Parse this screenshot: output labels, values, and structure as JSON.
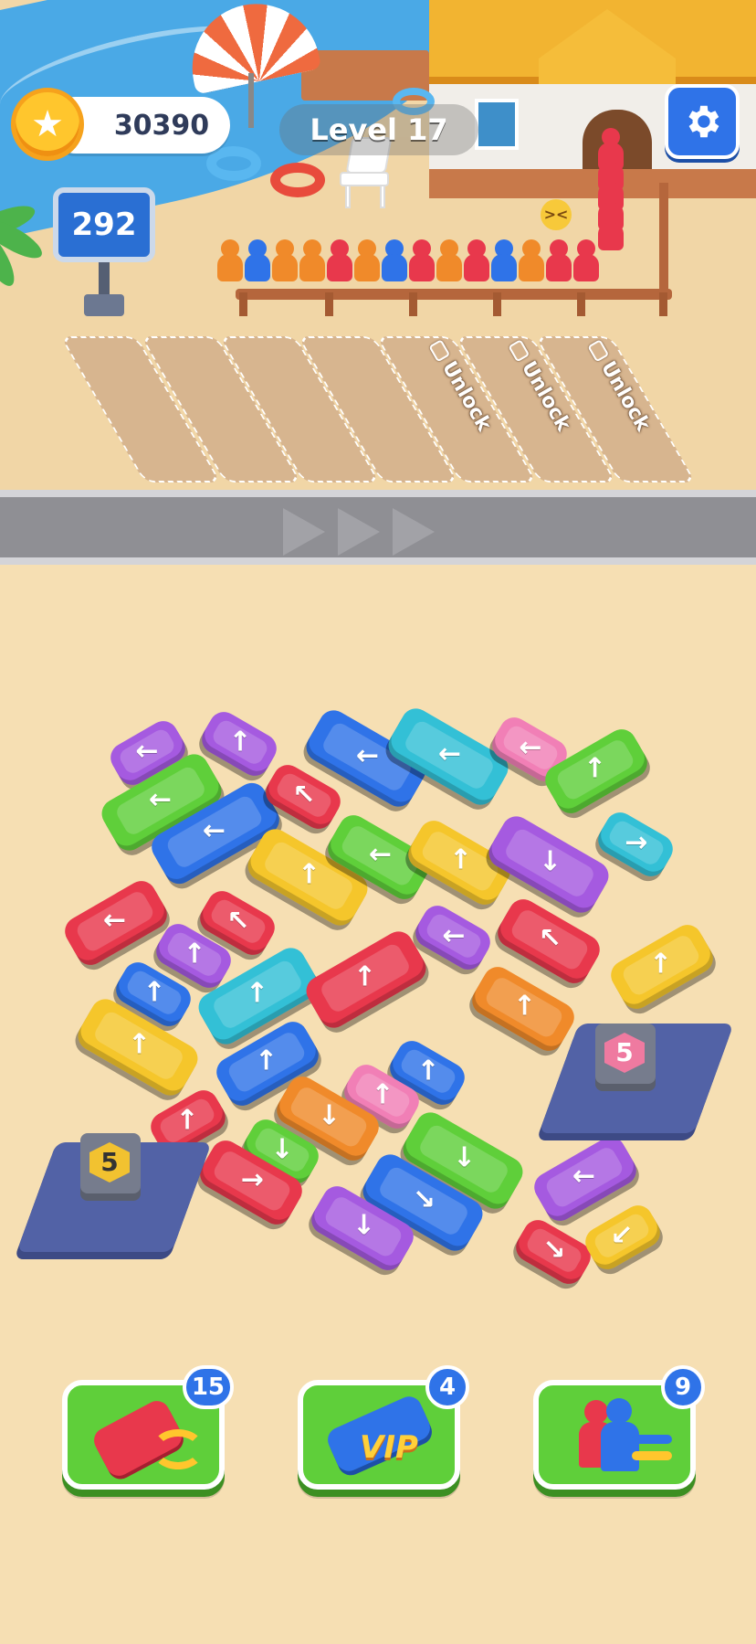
{
  "hud": {
    "coins": "30390",
    "level": "Level 17",
    "sign_count": "292"
  },
  "icons": {
    "coin": "star-coin-icon",
    "settings": "gear-icon"
  },
  "slots": {
    "unlock_label": "Unlock"
  },
  "parking": {
    "left_capacity": "5",
    "right_capacity": "5"
  },
  "boosters": [
    {
      "name": "shuffle-cars",
      "count": "15"
    },
    {
      "name": "vip-bus",
      "count": "4",
      "label": "VIP"
    },
    {
      "name": "swap-passengers",
      "count": "9"
    }
  ],
  "queue_colors": [
    "#f08a2a",
    "#2f73e8",
    "#f08a2a",
    "#f08a2a",
    "#e8384c",
    "#f08a2a",
    "#2f73e8",
    "#e8384c",
    "#f08a2a",
    "#e8384c",
    "#2f73e8",
    "#f08a2a",
    "#e8384c",
    "#e8384c"
  ],
  "colors": {
    "blue": "#2f73e8",
    "green": "#5fcf3a",
    "red": "#e8384c",
    "yellow": "#f5c62b",
    "purple": "#a55ae0",
    "cyan": "#33c0d6",
    "pink": "#f17fb6",
    "orange": "#f08a2a"
  }
}
